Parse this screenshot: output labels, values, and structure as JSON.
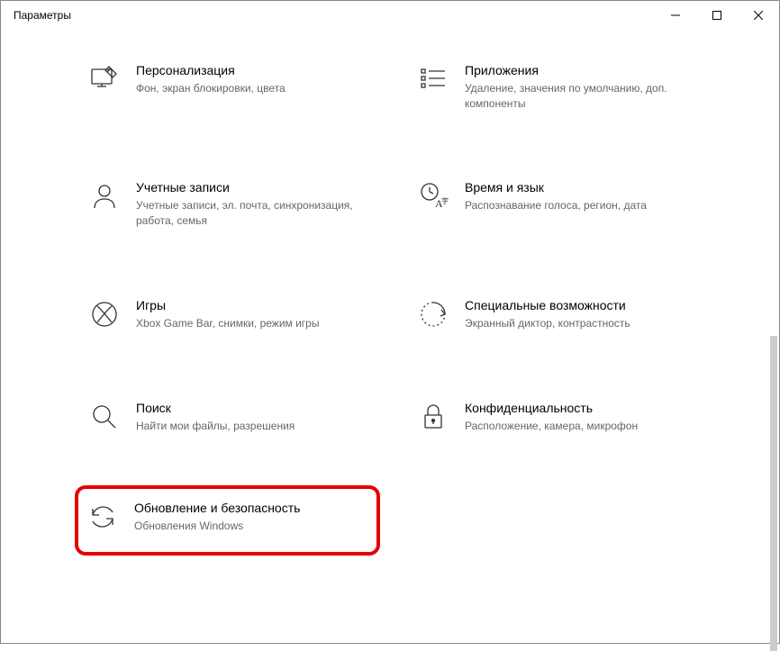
{
  "window": {
    "title": "Параметры"
  },
  "categories": {
    "personalization": {
      "title": "Персонализация",
      "desc": "Фон, экран блокировки, цвета"
    },
    "apps": {
      "title": "Приложения",
      "desc": "Удаление, значения по умолчанию, доп. компоненты"
    },
    "accounts": {
      "title": "Учетные записи",
      "desc": "Учетные записи, эл. почта, синхронизация, работа, семья"
    },
    "time": {
      "title": "Время и язык",
      "desc": "Распознавание голоса, регион, дата"
    },
    "gaming": {
      "title": "Игры",
      "desc": "Xbox Game Bar, снимки, режим игры"
    },
    "ease": {
      "title": "Специальные возможности",
      "desc": "Экранный диктор, контрастность"
    },
    "search": {
      "title": "Поиск",
      "desc": "Найти мои файлы, разрешения"
    },
    "privacy": {
      "title": "Конфиденциальность",
      "desc": "Расположение, камера, микрофон"
    },
    "update": {
      "title": "Обновление и безопасность",
      "desc": "Обновления Windows"
    }
  }
}
